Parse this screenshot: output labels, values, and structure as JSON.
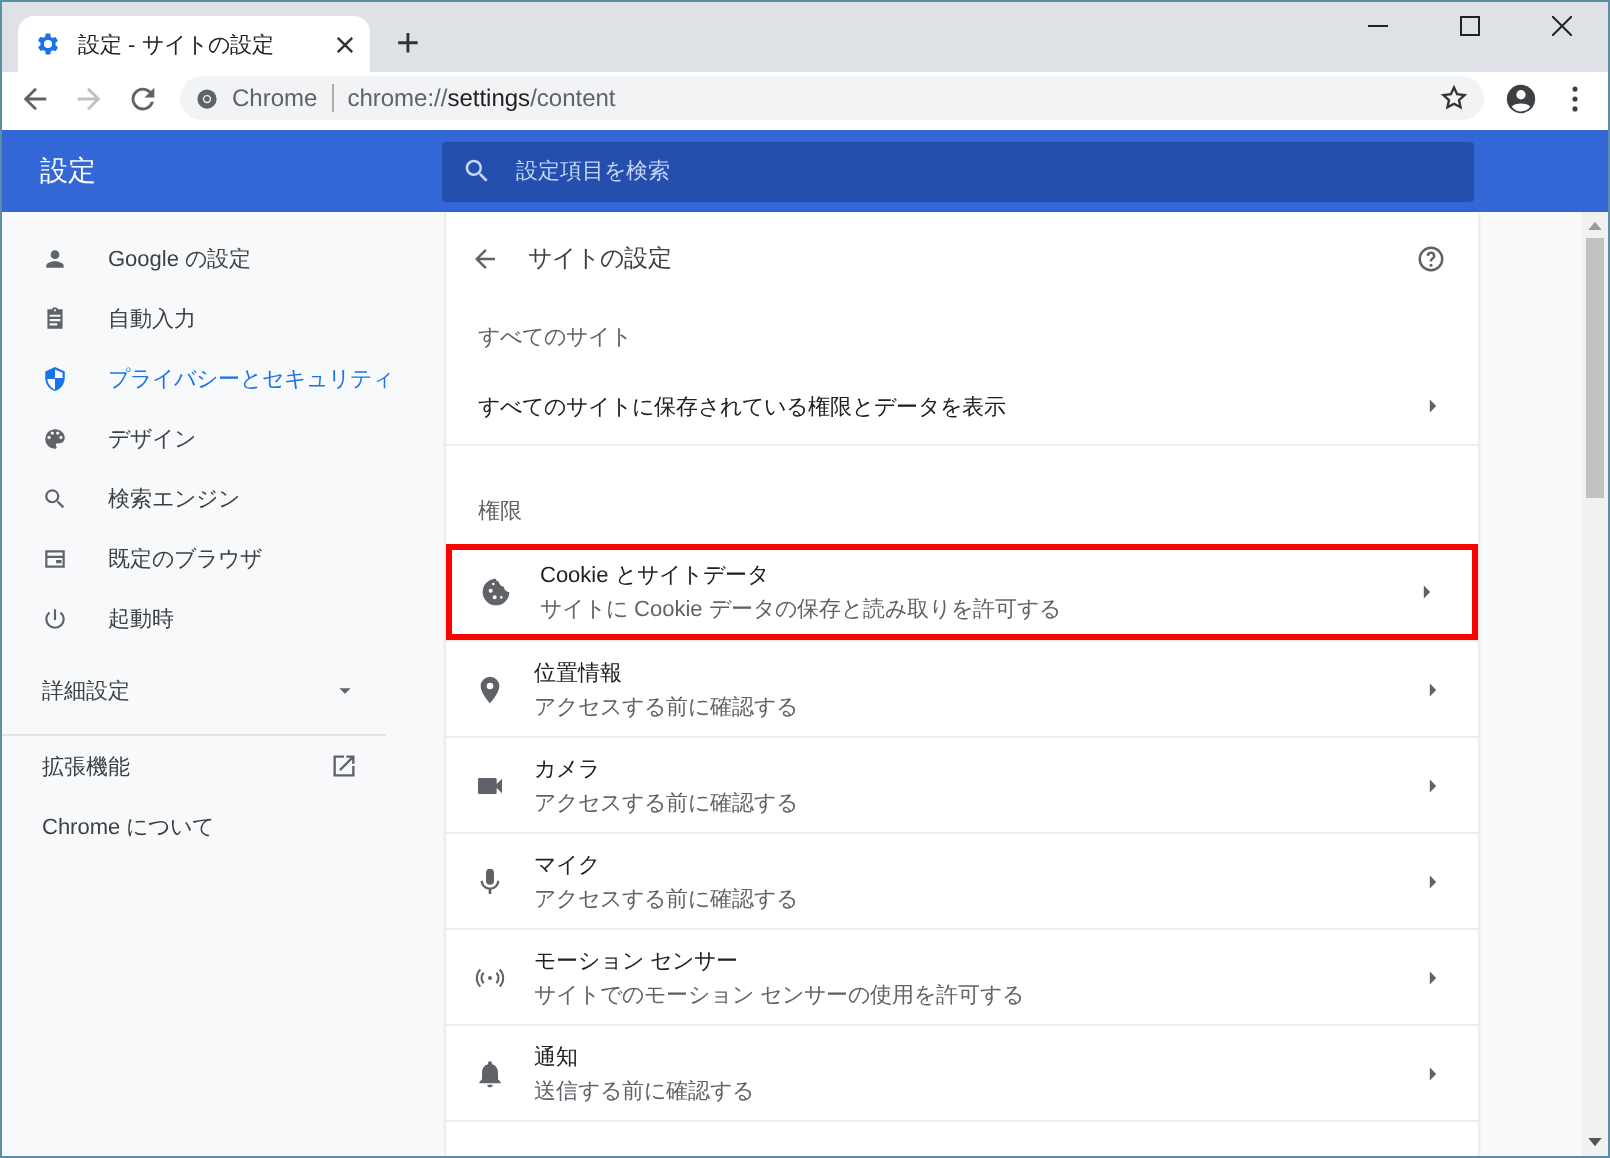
{
  "window": {
    "tab_title": "設定 - サイトの設定",
    "new_tab": "+"
  },
  "toolbar": {
    "site_label": "Chrome",
    "url_prefix": "chrome://",
    "url_host": "settings",
    "url_path": "/content"
  },
  "header": {
    "title": "設定",
    "search": {
      "placeholder": "設定項目を検索"
    }
  },
  "sidebar": {
    "items": [
      {
        "label": "Google の設定",
        "selected": false
      },
      {
        "label": "自動入力",
        "selected": false
      },
      {
        "label": "プライバシーとセキュリティ",
        "selected": true
      },
      {
        "label": "デザイン",
        "selected": false
      },
      {
        "label": "検索エンジン",
        "selected": false
      },
      {
        "label": "既定のブラウザ",
        "selected": false
      },
      {
        "label": "起動時",
        "selected": false
      }
    ],
    "advanced": {
      "label": "詳細設定",
      "expanded": false
    },
    "links": [
      {
        "label": "拡張機能",
        "external": true
      },
      {
        "label": "Chrome について",
        "external": false
      }
    ]
  },
  "content": {
    "title": "サイトの設定",
    "all_sites_heading": "すべてのサイト",
    "all_sites_link": "すべてのサイトに保存されている権限とデータを表示",
    "permissions_heading": "権限",
    "permissions": [
      {
        "title": "Cookie とサイトデータ",
        "subtitle": "サイトに Cookie データの保存と読み取りを許可する",
        "highlighted": true
      },
      {
        "title": "位置情報",
        "subtitle": "アクセスする前に確認する",
        "highlighted": false
      },
      {
        "title": "カメラ",
        "subtitle": "アクセスする前に確認する",
        "highlighted": false
      },
      {
        "title": "マイク",
        "subtitle": "アクセスする前に確認する",
        "highlighted": false
      },
      {
        "title": "モーション センサー",
        "subtitle": "サイトでのモーション センサーの使用を許可する",
        "highlighted": false
      },
      {
        "title": "通知",
        "subtitle": "送信する前に確認する",
        "highlighted": false
      }
    ]
  }
}
